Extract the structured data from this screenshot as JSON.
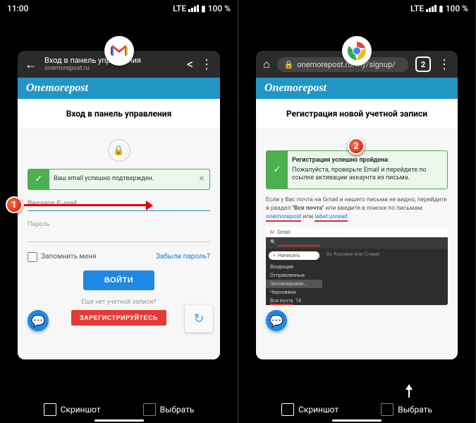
{
  "status": {
    "time": "11:00",
    "lte": "LTE",
    "battery": "100 %"
  },
  "left": {
    "tab": {
      "title": "Вход в панель управления",
      "subtitle": "onemorepost.ru"
    },
    "brand": "Onemorepost",
    "page_title": "Вход в панель управления",
    "success_msg": "Ваш email успешно подтвержден.",
    "email_placeholder": "Введите E-mail",
    "password_label": "Пароль",
    "remember": "Запомнить меня",
    "forgot": "Забыли пароль?",
    "login_btn": "ВОЙТИ",
    "no_account": "Еще нет учетной записи?",
    "register_btn": "ЗАРЕГИСТРИРУЙТЕСЬ"
  },
  "right": {
    "url": "onemorepost.ru/my/signup/",
    "tab_count": "2",
    "brand": "Onemorepost",
    "page_title": "Регистрация новой учетной записи",
    "success_title": "Регистрация успешно пройдена",
    "success_msg": "Пожалуйста, проверьте Email и перейдите по ссылке активации аккаунта из письма.",
    "help_p1a": "Если у Вас почта на Gmail и нашего письма не видно, перейдите в раздел ",
    "help_bold": "\"Вся почта\"",
    "help_p1b": " или введите в поиске по письмам: ",
    "help_link1": "onemorepost",
    "help_or": " или ",
    "help_link2": "label:unread",
    "gmail": {
      "brand": "Gmail",
      "compose": "Написать",
      "inbox": "Входящие",
      "sent": "Отправленные",
      "scheduled": "Запланирован...",
      "drafts": "Черновики",
      "all_mail": "Вся почта",
      "right_text": "Во Корзине или Спаме."
    }
  },
  "bottom": {
    "screenshot": "Скриншот",
    "select": "Выбрать"
  },
  "callouts": {
    "one": "1",
    "two": "2"
  }
}
